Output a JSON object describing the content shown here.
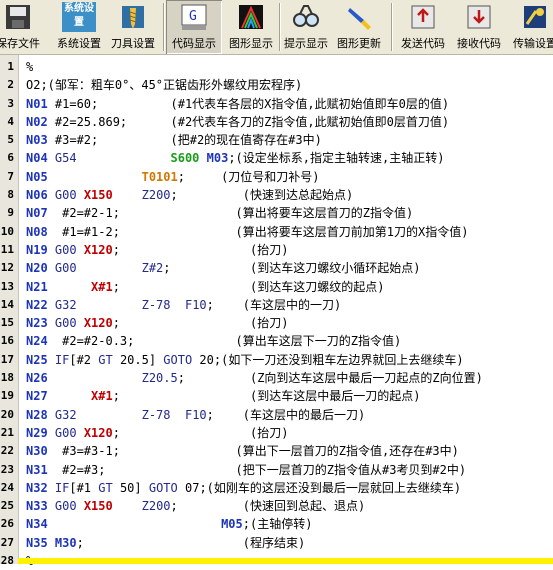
{
  "toolbar": {
    "buttons": [
      {
        "label": "保存文件"
      },
      {
        "label": "系统设置",
        "icon_text": "系统设置"
      },
      {
        "label": "刀具设置"
      },
      {
        "label": "代码显示"
      },
      {
        "label": "图形显示"
      },
      {
        "label": "提示显示"
      },
      {
        "label": "图形更新"
      },
      {
        "label": "发送代码"
      },
      {
        "label": "接收代码"
      },
      {
        "label": "传输设置"
      }
    ]
  },
  "colors": {
    "line_number_n": "#1d34b8",
    "x_address": "#c00000",
    "spindle": "#18a018",
    "tool": "#d27700",
    "highlight_bar": "#fff200"
  },
  "code_lines": [
    {
      "n": "1",
      "segs": [
        [
          "d",
          "%"
        ]
      ]
    },
    {
      "n": "2",
      "segs": [
        [
          "d",
          "O2;(邹军：粗车0°、45°正锯齿形外螺纹用宏程序)"
        ]
      ]
    },
    {
      "n": "3",
      "segs": [
        [
          "n",
          "N01 "
        ],
        [
          "d",
          "#1=60;          "
        ],
        [
          "c",
          "(#1代表车各层的X指令值,此赋初始值即车0层的值)"
        ]
      ]
    },
    {
      "n": "4",
      "segs": [
        [
          "n",
          "N02 "
        ],
        [
          "d",
          "#2=25.869;      "
        ],
        [
          "c",
          "(#2代表车各刀的Z指令值,此赋初始值即0层首刀值)"
        ]
      ]
    },
    {
      "n": "5",
      "segs": [
        [
          "n",
          "N03 "
        ],
        [
          "d",
          "#3=#2;          "
        ],
        [
          "c",
          "(把#2的现在值寄存在#3中)"
        ]
      ]
    },
    {
      "n": "6",
      "segs": [
        [
          "n",
          "N04 "
        ],
        [
          "k",
          "G54             "
        ],
        [
          "s",
          "S600 "
        ],
        [
          "n",
          "M03"
        ],
        [
          "c",
          ";(设定坐标系,指定主轴转速,主轴正转)"
        ]
      ]
    },
    {
      "n": "7",
      "segs": [
        [
          "n",
          "N05             "
        ],
        [
          "t",
          "T0101"
        ],
        [
          "c",
          ";     (刀位号和刀补号)"
        ]
      ]
    },
    {
      "n": "8",
      "segs": [
        [
          "n",
          "N06 "
        ],
        [
          "k",
          "G00 "
        ],
        [
          "x",
          "X150"
        ],
        [
          "d",
          "    "
        ],
        [
          "k",
          "Z200"
        ],
        [
          "c",
          ";         (快速到达总起始点)"
        ]
      ]
    },
    {
      "n": "9",
      "segs": [
        [
          "n",
          "N07 "
        ],
        [
          "d",
          " #2=#2-1;                "
        ],
        [
          "c",
          "(算出将要车这层首刀的Z指令值)"
        ]
      ]
    },
    {
      "n": "10",
      "segs": [
        [
          "n",
          "N08 "
        ],
        [
          "d",
          " #1=#1-2;                "
        ],
        [
          "c",
          "(算出将要车这层首刀前加第1刀的X指令值)"
        ]
      ]
    },
    {
      "n": "11",
      "segs": [
        [
          "n",
          "N19 "
        ],
        [
          "k",
          "G00 "
        ],
        [
          "x",
          "X120"
        ],
        [
          "c",
          ";                  (抬刀)"
        ]
      ]
    },
    {
      "n": "12",
      "segs": [
        [
          "n",
          "N20 "
        ],
        [
          "k",
          "G00         "
        ],
        [
          "k",
          "Z#2"
        ],
        [
          "c",
          ";           (到达车这刀螺纹小循环起始点)"
        ]
      ]
    },
    {
      "n": "13",
      "segs": [
        [
          "n",
          "N21      "
        ],
        [
          "x",
          "X#1"
        ],
        [
          "c",
          ";                  (到达车这刀螺纹的起点)"
        ]
      ]
    },
    {
      "n": "14",
      "segs": [
        [
          "n",
          "N22 "
        ],
        [
          "k",
          "G32         "
        ],
        [
          "k",
          "Z-78  "
        ],
        [
          "k",
          "F10"
        ],
        [
          "c",
          ";    (车这层中的一刀)"
        ]
      ]
    },
    {
      "n": "15",
      "segs": [
        [
          "n",
          "N23 "
        ],
        [
          "k",
          "G00 "
        ],
        [
          "x",
          "X120"
        ],
        [
          "c",
          ";                  (抬刀)"
        ]
      ]
    },
    {
      "n": "16",
      "segs": [
        [
          "n",
          "N24 "
        ],
        [
          "d",
          " #2=#2-0.3;              "
        ],
        [
          "c",
          "(算出车这层下一刀的Z指令值)"
        ]
      ]
    },
    {
      "n": "17",
      "segs": [
        [
          "n",
          "N25 "
        ],
        [
          "k",
          "IF"
        ],
        [
          "d",
          "[#2 "
        ],
        [
          "k",
          "GT"
        ],
        [
          "d",
          " 20.5] "
        ],
        [
          "k",
          "GOTO"
        ],
        [
          "d",
          " 20"
        ],
        [
          "c",
          ";(如下一刀还没到粗车左边界就回上去继续车)"
        ]
      ]
    },
    {
      "n": "18",
      "segs": [
        [
          "n",
          "N26             "
        ],
        [
          "k",
          "Z20.5"
        ],
        [
          "c",
          ";         (Z向到达车这层中最后一刀起点的Z向位置)"
        ]
      ]
    },
    {
      "n": "19",
      "segs": [
        [
          "n",
          "N27      "
        ],
        [
          "x",
          "X#1"
        ],
        [
          "c",
          ";                  (到达车这层中最后一刀的起点)"
        ]
      ]
    },
    {
      "n": "20",
      "segs": [
        [
          "n",
          "N28 "
        ],
        [
          "k",
          "G32         "
        ],
        [
          "k",
          "Z-78  "
        ],
        [
          "k",
          "F10"
        ],
        [
          "c",
          ";    (车这层中的最后一刀)"
        ]
      ]
    },
    {
      "n": "21",
      "segs": [
        [
          "n",
          "N29 "
        ],
        [
          "k",
          "G00 "
        ],
        [
          "x",
          "X120"
        ],
        [
          "c",
          ";                  (抬刀)"
        ]
      ]
    },
    {
      "n": "22",
      "segs": [
        [
          "n",
          "N30 "
        ],
        [
          "d",
          " #3=#3-1;                "
        ],
        [
          "c",
          "(算出下一层首刀的Z指令值,还存在#3中)"
        ]
      ]
    },
    {
      "n": "23",
      "segs": [
        [
          "n",
          "N31 "
        ],
        [
          "d",
          " #2=#3;                  "
        ],
        [
          "c",
          "(把下一层首刀的Z指令值从#3考贝到#2中)"
        ]
      ]
    },
    {
      "n": "24",
      "segs": [
        [
          "n",
          "N32 "
        ],
        [
          "k",
          "IF"
        ],
        [
          "d",
          "[#1 "
        ],
        [
          "k",
          "GT"
        ],
        [
          "d",
          " 50] "
        ],
        [
          "k",
          "GOTO"
        ],
        [
          "d",
          " 07"
        ],
        [
          "c",
          ";(如刚车的这层还没到最后一层就回上去继续车)"
        ]
      ]
    },
    {
      "n": "25",
      "segs": [
        [
          "n",
          "N33 "
        ],
        [
          "k",
          "G00 "
        ],
        [
          "x",
          "X150"
        ],
        [
          "d",
          "    "
        ],
        [
          "k",
          "Z200"
        ],
        [
          "c",
          ";         (快速回到总起、退点)"
        ]
      ]
    },
    {
      "n": "26",
      "segs": [
        [
          "n",
          "N34                        "
        ],
        [
          "n",
          "M05"
        ],
        [
          "c",
          ";(主轴停转)"
        ]
      ]
    },
    {
      "n": "27",
      "segs": [
        [
          "n",
          "N35 "
        ],
        [
          "n",
          "M30"
        ],
        [
          "c",
          ";                      (程序结束)"
        ]
      ]
    },
    {
      "n": "28",
      "segs": [
        [
          "d",
          "%"
        ]
      ]
    }
  ]
}
